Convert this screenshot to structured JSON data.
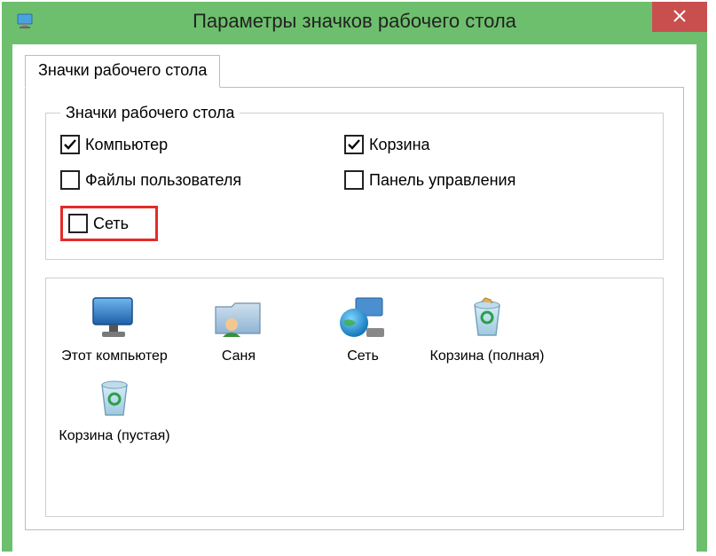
{
  "window": {
    "title": "Параметры значков рабочего стола"
  },
  "tab": {
    "label": "Значки рабочего стола"
  },
  "group": {
    "legend": "Значки рабочего стола",
    "checks": {
      "computer": {
        "label": "Компьютер",
        "checked": true
      },
      "recyclebin": {
        "label": "Корзина",
        "checked": true
      },
      "userfiles": {
        "label": "Файлы пользователя",
        "checked": false
      },
      "controlpanel": {
        "label": "Панель управления",
        "checked": false
      },
      "network": {
        "label": "Сеть",
        "checked": false
      }
    }
  },
  "icons": {
    "thispc": {
      "label": "Этот компьютер"
    },
    "user": {
      "label": "Саня"
    },
    "network": {
      "label": "Сеть"
    },
    "bin_full": {
      "label": "Корзина (полная)"
    },
    "bin_empty": {
      "label": "Корзина (пустая)"
    }
  }
}
